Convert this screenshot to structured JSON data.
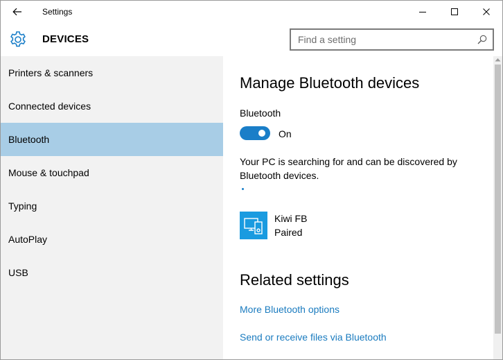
{
  "window": {
    "title": "Settings"
  },
  "header": {
    "title": "DEVICES",
    "search_placeholder": "Find a setting"
  },
  "sidebar": {
    "items": [
      {
        "label": "Printers & scanners"
      },
      {
        "label": "Connected devices"
      },
      {
        "label": "Bluetooth"
      },
      {
        "label": "Mouse & touchpad"
      },
      {
        "label": "Typing"
      },
      {
        "label": "AutoPlay"
      },
      {
        "label": "USB"
      }
    ],
    "selected_index": 2
  },
  "main": {
    "heading": "Manage Bluetooth devices",
    "bluetooth_label": "Bluetooth",
    "toggle_state": "On",
    "description": "Your PC is searching for and can be discovered by Bluetooth devices.",
    "device": {
      "name": "Kiwi FB",
      "status": "Paired",
      "icon": "devices-icon"
    },
    "related_heading": "Related settings",
    "links": [
      {
        "label": "More Bluetooth options"
      },
      {
        "label": "Send or receive files via Bluetooth"
      }
    ]
  },
  "colors": {
    "accent": "#1a7ec8",
    "selected_bg": "#a8cde6",
    "sidebar_bg": "#f2f2f2",
    "link": "#1a7bbf",
    "device_tile": "#1a9be0"
  }
}
